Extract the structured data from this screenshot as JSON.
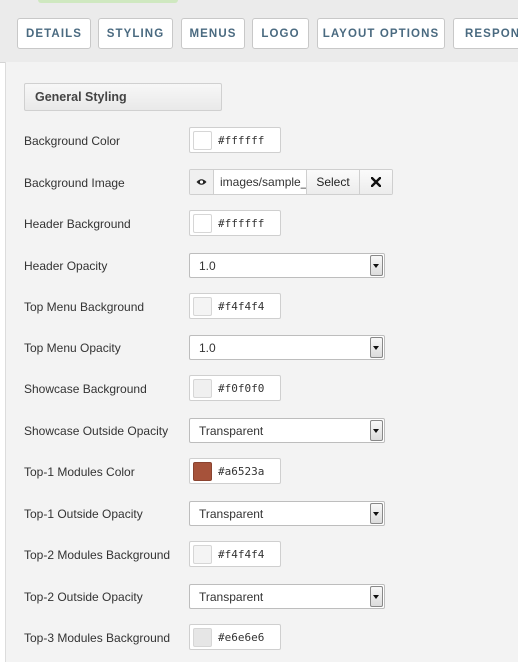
{
  "tabs": [
    "DETAILS",
    "STYLING",
    "MENUS",
    "LOGO",
    "LAYOUT OPTIONS",
    "RESPONS"
  ],
  "section_title": "General Styling",
  "fields": [
    {
      "label": "Background Color",
      "type": "color",
      "value": "#ffffff",
      "swatch": "#ffffff"
    },
    {
      "label": "Background Image",
      "type": "media",
      "value": "images/sample_",
      "select_label": "Select"
    },
    {
      "label": "Header Background",
      "type": "color",
      "value": "#ffffff",
      "swatch": "#ffffff"
    },
    {
      "label": "Header Opacity",
      "type": "select",
      "value": "1.0"
    },
    {
      "label": "Top Menu Background",
      "type": "color",
      "value": "#f4f4f4",
      "swatch": "#f4f4f4"
    },
    {
      "label": "Top Menu Opacity",
      "type": "select",
      "value": "1.0"
    },
    {
      "label": "Showcase Background",
      "type": "color",
      "value": "#f0f0f0",
      "swatch": "#f0f0f0"
    },
    {
      "label": "Showcase Outside Opacity",
      "type": "select",
      "value": "Transparent"
    },
    {
      "label": "Top-1 Modules Color",
      "type": "color",
      "value": "#a6523a",
      "swatch": "#a6523a"
    },
    {
      "label": "Top-1 Outside Opacity",
      "type": "select",
      "value": "Transparent"
    },
    {
      "label": "Top-2 Modules Background",
      "type": "color",
      "value": "#f4f4f4",
      "swatch": "#f4f4f4"
    },
    {
      "label": "Top-2 Outside Opacity",
      "type": "select",
      "value": "Transparent"
    },
    {
      "label": "Top-3 Modules Background",
      "type": "color",
      "value": "#e6e6e6",
      "swatch": "#e6e6e6"
    }
  ]
}
